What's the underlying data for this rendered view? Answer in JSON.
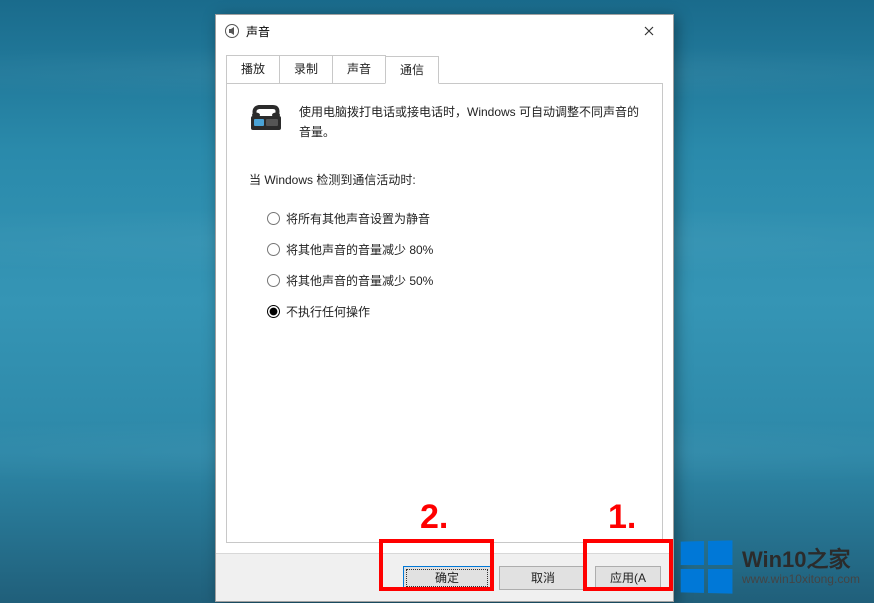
{
  "dialog": {
    "title": "声音",
    "tabs": [
      {
        "label": "播放",
        "active": false
      },
      {
        "label": "录制",
        "active": false
      },
      {
        "label": "声音",
        "active": false
      },
      {
        "label": "通信",
        "active": true
      }
    ],
    "intro": "使用电脑拨打电话或接电话时，Windows 可自动调整不同声音的音量。",
    "detectLabel": "当 Windows 检测到通信活动时:",
    "options": [
      {
        "label": "将所有其他声音设置为静音",
        "selected": false
      },
      {
        "label": "将其他声音的音量减少 80%",
        "selected": false
      },
      {
        "label": "将其他声音的音量减少 50%",
        "selected": false
      },
      {
        "label": "不执行任何操作",
        "selected": true
      }
    ],
    "buttons": {
      "ok": "确定",
      "cancel": "取消",
      "apply": "应用(A"
    }
  },
  "annotations": {
    "label1": "1.",
    "label2": "2."
  },
  "watermark": {
    "title": "Win10之家",
    "url": "www.win10xitong.com"
  }
}
